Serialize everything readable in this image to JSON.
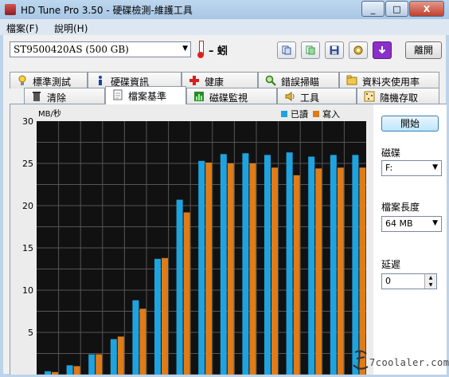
{
  "window": {
    "title": "HD Tune Pro 3.50 - 硬碟檢測-維護工具",
    "buttons": {
      "minimize": "_",
      "maximize": "□",
      "close": "X"
    }
  },
  "menu": {
    "file": "檔案(F)",
    "help": "說明(H)"
  },
  "toolbar": {
    "drive": "ST9500420AS (500 GB)",
    "temperature": "– 蚓",
    "exit_label": "離開",
    "icons": [
      "copy-text-icon",
      "copy-screenshot-icon",
      "save-icon",
      "settings-icon",
      "download-icon"
    ]
  },
  "tabs_top": [
    {
      "label": "標準測試",
      "icon": "bulb-icon"
    },
    {
      "label": "硬碟資訊",
      "icon": "info-icon"
    },
    {
      "label": "健康",
      "icon": "health-cross-icon"
    },
    {
      "label": "錯誤掃瞄",
      "icon": "magnifier-icon"
    },
    {
      "label": "資料夾使用率",
      "icon": "folder-icon"
    }
  ],
  "tabs_bottom": [
    {
      "label": "清除",
      "icon": "trash-icon"
    },
    {
      "label": "檔案基準",
      "icon": "file-icon"
    },
    {
      "label": "磁碟監視",
      "icon": "monitor-icon"
    },
    {
      "label": "工具",
      "icon": "speaker-icon"
    },
    {
      "label": "隨機存取",
      "icon": "random-icon"
    }
  ],
  "side": {
    "start_label": "開始",
    "disk_label": "磁碟",
    "disk_value": "F:",
    "length_label": "檔案長度",
    "length_value": "64 MB",
    "delay_label": "延遲",
    "delay_value": "0"
  },
  "watermark": "7coolaler.com",
  "colors": {
    "read": "#1fa3df",
    "write": "#e07b17",
    "plot_bg": "#111111"
  },
  "chart_data": {
    "type": "bar",
    "ylabel": "MB/秒",
    "ylim": [
      0,
      30
    ],
    "yticks": [
      5,
      10,
      15,
      20,
      25,
      30
    ],
    "grid": true,
    "legend_position": "top-right",
    "series": [
      {
        "name": "已讀",
        "values": [
          0.4,
          1.1,
          2.4,
          4.2,
          8.8,
          13.7,
          20.7,
          25.3,
          26.1,
          26.2,
          26.0,
          26.3,
          25.8,
          26.0,
          26.0
        ]
      },
      {
        "name": "寫入",
        "values": [
          0.3,
          1.0,
          2.4,
          4.5,
          7.8,
          13.8,
          19.2,
          25.1,
          25.0,
          25.0,
          24.5,
          23.6,
          24.4,
          24.5,
          24.5
        ]
      }
    ]
  }
}
